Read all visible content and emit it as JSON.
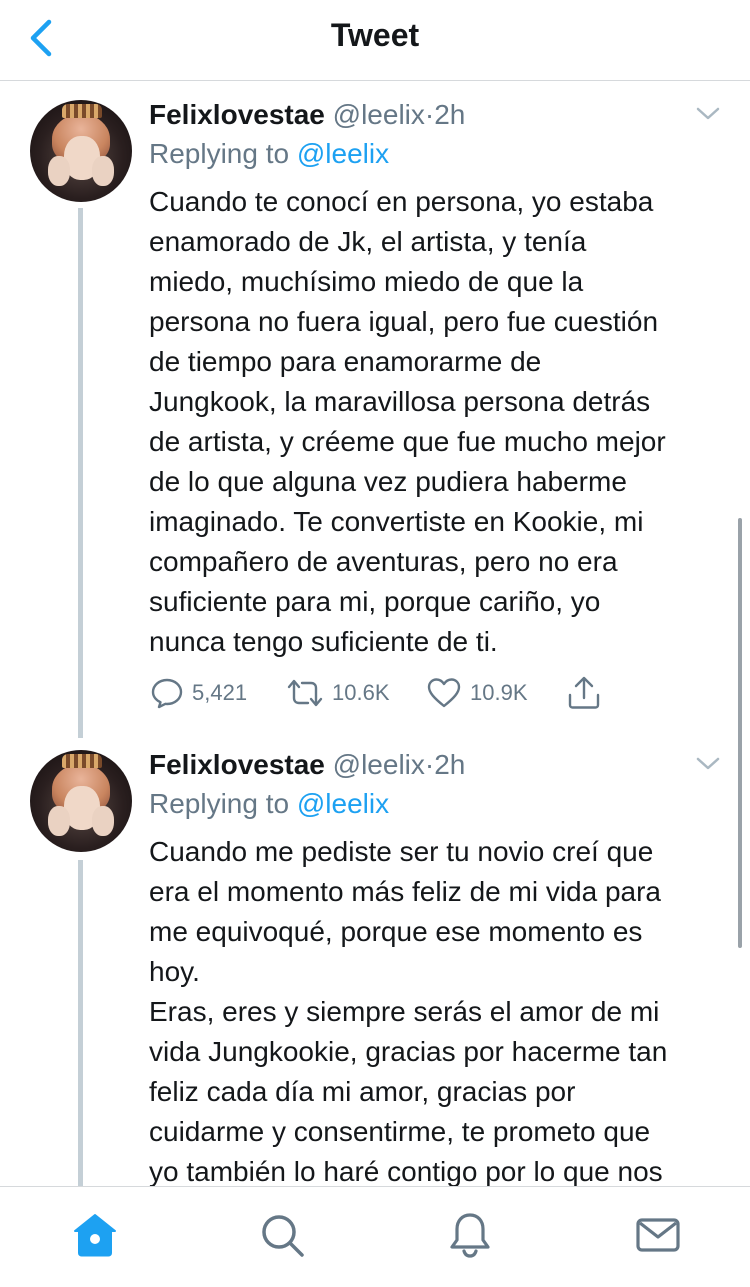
{
  "header": {
    "title": "Tweet",
    "back_icon": "chevron-left-icon"
  },
  "colors": {
    "accent": "#1da1f2",
    "text": "#14171a",
    "muted": "#657786",
    "thread_line": "#c4cfd6"
  },
  "tweets": [
    {
      "display_name": "Felixlovestae",
      "handle": "@leelix",
      "dot": "·",
      "time": "2h",
      "replying_prefix": "Replying to",
      "replying_handle": "@leelix",
      "lines": [
        "Cuando te conocí en persona, yo estaba",
        "enamorado de Jk, el artista, y tenía",
        "miedo, muchísimo miedo de que la",
        "persona no fuera igual, pero fue cuestión",
        "de tiempo para enamorarme de",
        "Jungkook, la maravillosa persona detrás",
        "de artista, y créeme que fue mucho mejor",
        "de lo que alguna vez pudiera haberme",
        "imaginado. Te convertiste en Kookie, mi",
        "compañero de aventuras, pero no era",
        "suficiente para mi, porque cariño, yo",
        "nunca tengo suficiente de ti."
      ],
      "stats": {
        "replies": "5,421",
        "retweets": "10.6K",
        "likes": "10.9K"
      }
    },
    {
      "display_name": "Felixlovestae",
      "handle": "@leelix",
      "dot": "·",
      "time": "2h",
      "replying_prefix": "Replying to",
      "replying_handle": "@leelix",
      "lines": [
        "Cuando me pediste ser tu novio creí que",
        "era el momento más feliz de mi vida para",
        "me equivoqué, porque ese momento es",
        "hoy.",
        "Eras, eres y siempre serás el amor de mi",
        "vida Jungkookie, gracias por hacerme tan",
        "feliz cada día mi amor, gracias por",
        "cuidarme y consentirme, te prometo que",
        "yo también lo haré contigo por lo que nos"
      ]
    }
  ],
  "tabbar": {
    "items": [
      "home-icon",
      "search-icon",
      "bell-icon",
      "mail-icon"
    ],
    "active": "home-icon"
  }
}
